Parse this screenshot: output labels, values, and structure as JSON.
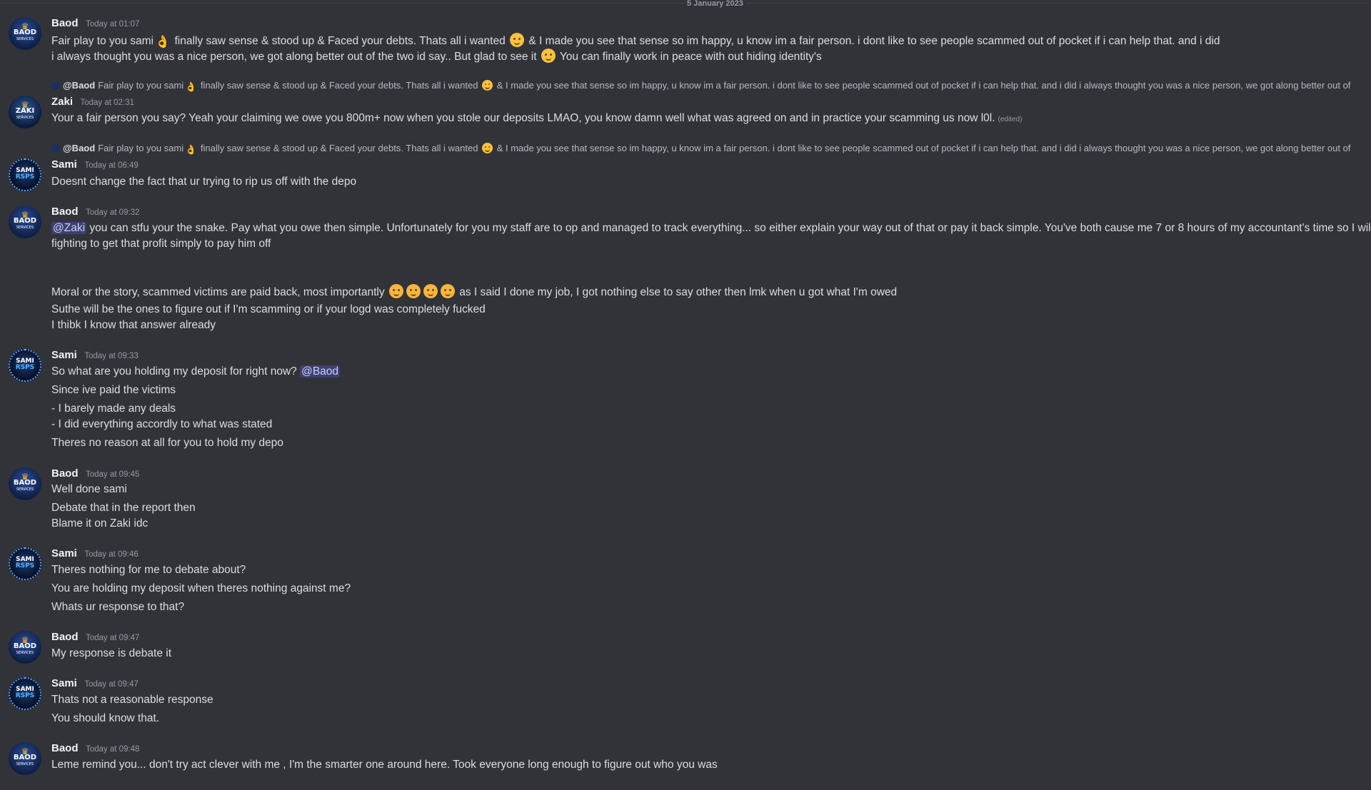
{
  "date_divider": "5 January 2023",
  "messages": [
    {
      "author": "Baod",
      "timestamp": "Today at 01:07",
      "lines": [
        {
          "a": "Fair play to you sami",
          "b": " finally saw sense & stood up & Faced your debts. Thats all i wanted ",
          "c": " & I made you see that sense so im happy, u know im a fair person. i dont like to see people scammed out of pocket if i can help that. and i did"
        },
        {
          "a": "i always thought you was a nice person, we got along better out of the two id say.. But glad to see it ",
          "b": " You can finally work in peace with out hiding identity's"
        }
      ]
    },
    {
      "reply_to": "@Baod",
      "reply_a": "Fair play to you sami",
      "reply_b": " finally saw sense & stood up & Faced your debts. Thats all i wanted ",
      "reply_c": " & I made you see that sense so im happy, u know im a fair person. i dont like to see people scammed out of pocket if i can help that. and i did i always thought you was a nice person, we got along better out of",
      "author": "Zaki",
      "timestamp": "Today at 02:31",
      "text": "Your a fair person you say? Yeah your claiming we owe you 800m+ now when you stole our deposits LMAO, you know damn well what was agreed on and in practice your scamming us now l0l.",
      "edited": "(edited)"
    },
    {
      "reply_to": "@Baod",
      "reply_a": "Fair play to you sami",
      "reply_b": " finally saw sense & stood up & Faced your debts. Thats all i wanted ",
      "reply_c": " & I made you see that sense so im happy, u know im a fair person. i dont like to see people scammed out of pocket if i can help that. and i did i always thought you was a nice person, we got along better out of",
      "author": "Sami",
      "timestamp": "Today at 06:49",
      "text": "Doesnt change the fact that ur trying to rip us off with the depo"
    },
    {
      "author": "Baod",
      "timestamp": "Today at 09:32",
      "mention": "@Zaki",
      "line1": " you can stfu your the snake. Pay what you owe then simple. Unfortunately for you my staff are to op and managed to track everything... so either explain your way out of that or pay it back simple. You've both cause me 7 or 8 hours of my accountant's time so I will be",
      "line2": "fighting to get that profit simply to pay him off",
      "line3a": "Moral or the story, scammed victims are paid back, most importantly ",
      "line3b": " as I said I done my job, I got nothing else to say  other then lmk when u got what I'm owed",
      "line4": "Suthe will be the ones to figure out if I'm scamming or if your logd was completely fucked",
      "line5": "I thibk I know that answer already"
    },
    {
      "author": "Sami",
      "timestamp": "Today at 09:33",
      "line1": "So what are you holding my deposit for right now? ",
      "mention": "@Baod",
      "line2": "Since ive paid the victims",
      "line3": "- I barely made any deals",
      "line4": "- I did everything accordly to what was stated",
      "line5": "Theres no reason at all for you to hold my depo"
    },
    {
      "author": "Baod",
      "timestamp": "Today at 09:45",
      "line1": "Well done sami",
      "line2": "Debate that in the report then",
      "line3": " Blame it on Zaki idc"
    },
    {
      "author": "Sami",
      "timestamp": "Today at 09:46",
      "line1": "Theres nothing for me to debate about?",
      "line2": "You are holding my deposit when theres nothing against me?",
      "line3": "Whats ur response to that?"
    },
    {
      "author": "Baod",
      "timestamp": "Today at 09:47",
      "line1": "My response is debate it"
    },
    {
      "author": "Sami",
      "timestamp": "Today at 09:47",
      "line1": "Thats not a reasonable response",
      "line2": "You should know that."
    },
    {
      "author": "Baod",
      "timestamp": "Today at 09:48",
      "line1": "Leme remind you... don't try act clever with me , I'm the smarter one around here. Took everyone long enough to figure out who you was"
    }
  ],
  "avatars": {
    "baod": {
      "line1": "BAOD",
      "line2": "SERVICES"
    },
    "sami": {
      "line1": "SAMI",
      "line2": "RSPS"
    },
    "zaki": {
      "line1": "ZAKI",
      "line2": "SERVICES"
    }
  },
  "colors": {
    "background": "#313338",
    "text": "#dbdee1",
    "author": "#f2f3f5",
    "muted": "#949ba4",
    "mention_bg": "#5865f2"
  }
}
